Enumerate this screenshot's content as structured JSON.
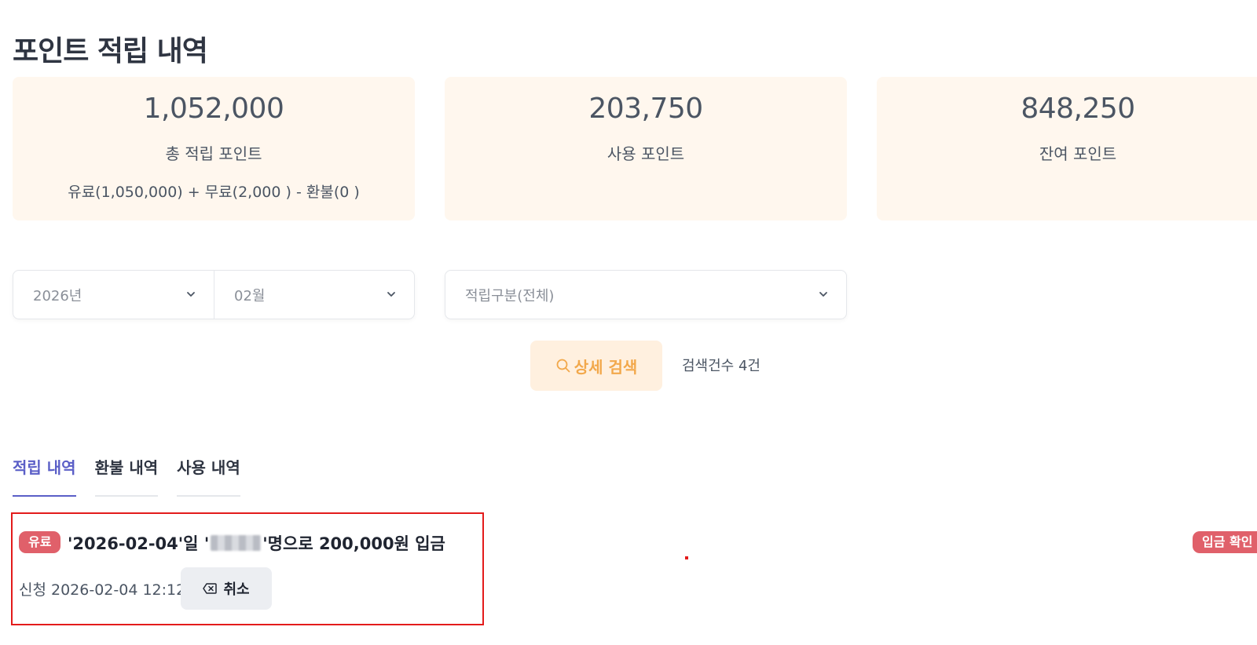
{
  "page": {
    "title": "포인트 적립 내역"
  },
  "stats": [
    {
      "value": "1,052,000",
      "label": "총 적립 포인트",
      "sub": "유료(1,050,000) + 무료(2,000 ) - 환불(0 )"
    },
    {
      "value": "203,750",
      "label": "사용 포인트",
      "sub": ""
    },
    {
      "value": "848,250",
      "label": "잔여 포인트",
      "sub": ""
    }
  ],
  "filters": {
    "year": "2026년",
    "month": "02월",
    "category": "적립구분(전체)"
  },
  "search": {
    "button_label": "상세 검색",
    "count_text": "검색건수 4건"
  },
  "tabs": [
    {
      "label": "적립 내역",
      "active": true
    },
    {
      "label": "환불 내역",
      "active": false
    },
    {
      "label": "사용 내역",
      "active": false
    }
  ],
  "record": {
    "badge": "유료",
    "title_prefix": "'2026-02-04'일 '",
    "title_suffix": "'명으로 200,000원 입금",
    "requested": "신청 2026-02-04 12:12",
    "cancel_label": "취소",
    "status_badge": "입금 확인 중"
  },
  "colors": {
    "accent": "#5b5fc7",
    "card_bg": "#fff7ee",
    "search_btn_bg": "#fff0df",
    "search_btn_text": "#f2a84b",
    "badge_red": "#e0606a",
    "highlight_border": "#e31b1b"
  }
}
